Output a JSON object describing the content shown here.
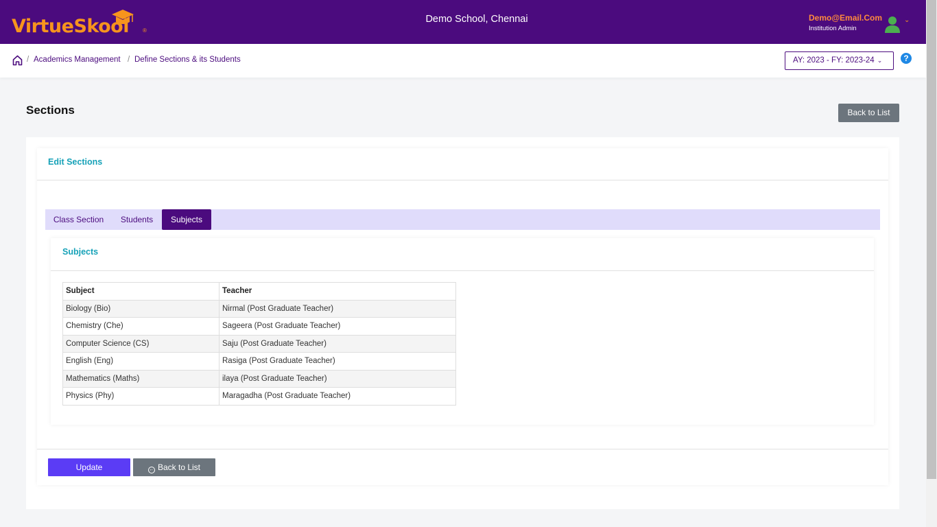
{
  "header": {
    "logo": "VirtueSkool",
    "logo_part1": "Virtue",
    "logo_part2": "Skool",
    "logo_reg": "®",
    "school_name": "Demo School, Chennai",
    "user_email": "Demo@Email.Com",
    "user_role": "Institution Admin",
    "brand_color": "#4b0b7e",
    "accent_color": "#f7941d"
  },
  "breadcrumb": {
    "items": [
      "Academics Management",
      "Define Sections & its Students"
    ],
    "separator": "/"
  },
  "year_selector": {
    "value": "AY: 2023 - FY: 2023-24"
  },
  "help_icon": "?",
  "page": {
    "title": "Sections",
    "back_button": "Back to List"
  },
  "card": {
    "title": "Edit Sections",
    "tabs": [
      {
        "label": "Class Section",
        "active": false
      },
      {
        "label": "Students",
        "active": false
      },
      {
        "label": "Subjects",
        "active": true
      }
    ],
    "subjects": {
      "title": "Subjects",
      "columns": [
        "Subject",
        "Teacher"
      ],
      "rows": [
        [
          "Biology (Bio)",
          "Nirmal (Post Graduate Teacher)"
        ],
        [
          "Chemistry (Che)",
          "Sageera (Post Graduate Teacher)"
        ],
        [
          "Computer Science (CS)",
          "Saju (Post Graduate Teacher)"
        ],
        [
          "English (Eng)",
          "Rasiga (Post Graduate Teacher)"
        ],
        [
          "Mathematics (Maths)",
          "ilaya (Post Graduate Teacher)"
        ],
        [
          "Physics (Phy)",
          "Maragadha (Post Graduate Teacher)"
        ]
      ]
    },
    "update_button": "Update",
    "back_button": "Back to List"
  }
}
